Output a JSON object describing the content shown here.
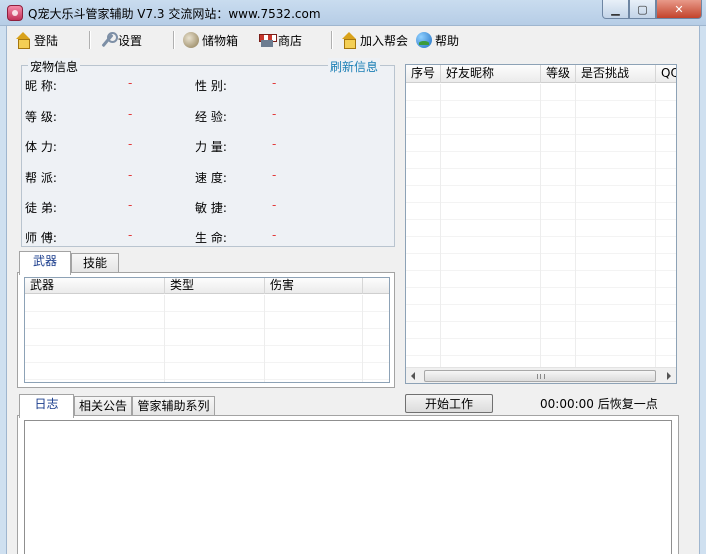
{
  "window": {
    "title": "Q宠大乐斗管家辅助 V7.3 交流网站：www.7532.com",
    "controls": {
      "minimize": "▁",
      "maximize": "▢",
      "close": "✕"
    }
  },
  "toolbar": {
    "login": {
      "label": "登陆",
      "icon": "house-icon"
    },
    "settings": {
      "label": "设置",
      "icon": "wrench-icon"
    },
    "storage": {
      "label": "储物箱",
      "icon": "storage-box-icon"
    },
    "shop": {
      "label": "商店",
      "icon": "shop-icon"
    },
    "join_gang": {
      "label": "加入帮会",
      "icon": "house-icon"
    },
    "help": {
      "label": "帮助",
      "icon": "help-globe-icon"
    }
  },
  "pet_info": {
    "title": "宠物信息",
    "refresh_label": "刷新信息",
    "fields": [
      {
        "label": "昵   称:",
        "value": "-"
      },
      {
        "label": "等   级:",
        "value": "-"
      },
      {
        "label": "体   力:",
        "value": "-"
      },
      {
        "label": "帮   派:",
        "value": "-"
      },
      {
        "label": "徒   弟:",
        "value": "-"
      },
      {
        "label": "师   傅:",
        "value": "-"
      },
      {
        "label": "性   别:",
        "value": "-"
      },
      {
        "label": "经   验:",
        "value": "-"
      },
      {
        "label": "力   量:",
        "value": "-"
      },
      {
        "label": "速   度:",
        "value": "-"
      },
      {
        "label": "敏   捷:",
        "value": "-"
      },
      {
        "label": "生   命:",
        "value": "-"
      }
    ]
  },
  "friend_list": {
    "columns": [
      "序号",
      "好友昵称",
      "等级",
      "是否挑战",
      "QQ"
    ],
    "scroll_grip": "III"
  },
  "equipment_tabs": {
    "tabs": [
      "武器",
      "技能"
    ],
    "active": 0,
    "columns": [
      "武器",
      "类型",
      "伤害"
    ]
  },
  "actions": {
    "start_label": "开始工作",
    "timer_text": "00:00:00 后恢复一点"
  },
  "log_tabs": {
    "tabs": [
      "日志",
      "相关公告",
      "管家辅助系列"
    ],
    "active": 0
  }
}
